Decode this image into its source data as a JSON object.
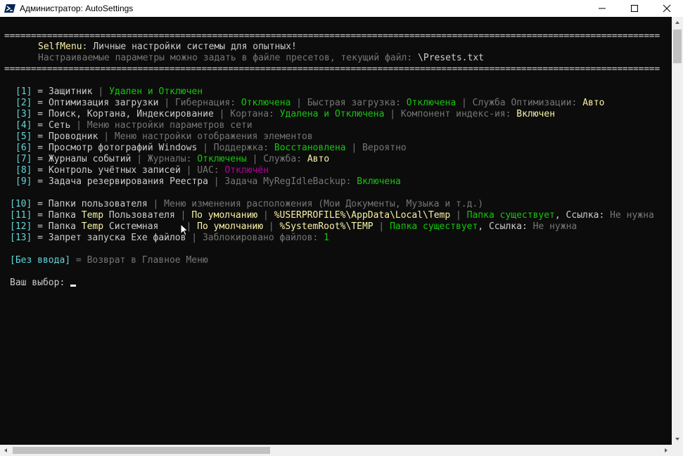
{
  "window": {
    "title": "Администратор: AutoSettings",
    "minimize_glyph": "—",
    "maximize_glyph": "☐",
    "close_glyph": "✕"
  },
  "console": {
    "separator": "===========================================================================================================================",
    "header": {
      "name": "SelfMenu",
      "name_rest": ": Личные настройки системы для опытных!",
      "presets_text": "Настраиваемые параметры можно задать в файле пресетов, текущий файл: ",
      "presets_file": "\\Presets.txt"
    },
    "items": {
      "i1": {
        "num": "[1]",
        "label": " = Защитник ",
        "pipe": "| ",
        "status": "Удален и Отключен"
      },
      "i2": {
        "num": "[2]",
        "label": " = Оптимизация загрузки ",
        "p1": "| Гибернация: ",
        "v1": "Отключена",
        "p2": " | Быстрая загрузка: ",
        "v2": "Отключена",
        "p3": " | Служба Оптимизации: ",
        "v3": "Авто"
      },
      "i3": {
        "num": "[3]",
        "label": " = Поиск, Кортана, Индексирование ",
        "p1": "| Кортана: ",
        "v1": "Удалена и Отключена",
        "p2": " | Компонент индекс-ия: ",
        "v2": "Включен"
      },
      "i4": {
        "num": "[4]",
        "label": " = Сеть ",
        "p1": "| Меню настройки параметров сети"
      },
      "i5": {
        "num": "[5]",
        "label": " = Проводник ",
        "p1": "| Меню настройки отображения элементов"
      },
      "i6": {
        "num": "[6]",
        "label": " = Просмотр фотографий Windows ",
        "p1": "| Поддержка: ",
        "v1": "Восстановлена",
        "p2": " | Вероятно"
      },
      "i7": {
        "num": "[7]",
        "label": " = Журналы событий ",
        "p1": "| Журналы: ",
        "v1": "Отключены",
        "p2": " | Служба: ",
        "v2": "Авто"
      },
      "i8": {
        "num": "[8]",
        "label": " = Контроль учётных записей ",
        "p1": "| UAC: ",
        "v1": "Отключён"
      },
      "i9": {
        "num": "[9]",
        "label": " = Задача резервирования Реестра ",
        "p1": "| Задача MyRegIdleBackup: ",
        "v1": "Включена"
      },
      "i10": {
        "num": "[10]",
        "label": " = Папки пользователя ",
        "p1": "| Меню изменения расположения (Мои Документы, Музыка и т.д.)"
      },
      "i11": {
        "num": "[11]",
        "a": " = Папка ",
        "temp": "Temp",
        "b": " Пользователя ",
        "pipe1": "| ",
        "def": "По умолчанию",
        "pipe2": " | ",
        "path": "%USERPROFILE%\\AppData\\Local\\Temp",
        "pipe3": " | ",
        "exists": "Папка существует",
        "link": ", Ссылка: ",
        "notneed": "Не нужна"
      },
      "i12": {
        "num": "[12]",
        "a": " = Папка ",
        "temp": "Temp",
        "b": " Системная     ",
        "pipe1": "| ",
        "def": "По умолчанию",
        "pipe2": " | ",
        "path": "%SystemRoot%\\TEMP",
        "pipe3": " | ",
        "exists": "Папка существует",
        "link": ", Ссылка: ",
        "notneed": "Не нужна"
      },
      "i13": {
        "num": "[13]",
        "label": " = Запрет запуска Exe файлов ",
        "p1": "| Заблокировано файлов: ",
        "v1": "1"
      }
    },
    "back": {
      "key": "[Без ввода]",
      "text": " = Возврат в Главное Меню"
    },
    "prompt": "Ваш выбор: "
  }
}
